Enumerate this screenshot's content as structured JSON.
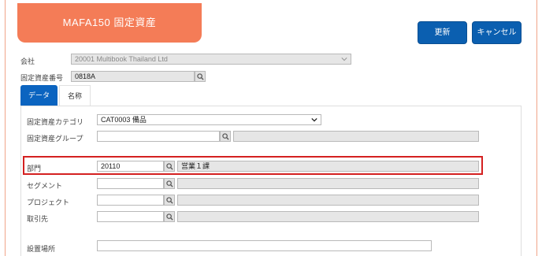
{
  "header": {
    "title": "MAFA150 固定資産",
    "update_label": "更新",
    "cancel_label": "キャンセル"
  },
  "company": {
    "label": "会社",
    "value": "20001 Multibook Thailand Ltd"
  },
  "asset_number": {
    "label": "固定資産番号",
    "value": "0818A"
  },
  "tabs": [
    {
      "label": "データ",
      "active": true
    },
    {
      "label": "名称",
      "active": false
    }
  ],
  "form": {
    "category": {
      "label": "固定資産カテゴリ",
      "value": "CAT0003 備品"
    },
    "group": {
      "label": "固定資産グループ",
      "value": "",
      "name": ""
    },
    "department": {
      "label": "部門",
      "value": "20110",
      "name": "営業１課"
    },
    "segment": {
      "label": "セグメント",
      "value": "",
      "name": ""
    },
    "project": {
      "label": "プロジェクト",
      "value": "",
      "name": ""
    },
    "partner": {
      "label": "取引先",
      "value": "",
      "name": ""
    },
    "location": {
      "label": "設置場所",
      "value": ""
    }
  },
  "colors": {
    "title_bg": "#f47c57",
    "button_bg": "#0b5fb0",
    "tab_active_bg": "#0b64c0",
    "highlight_border": "#d42121"
  }
}
